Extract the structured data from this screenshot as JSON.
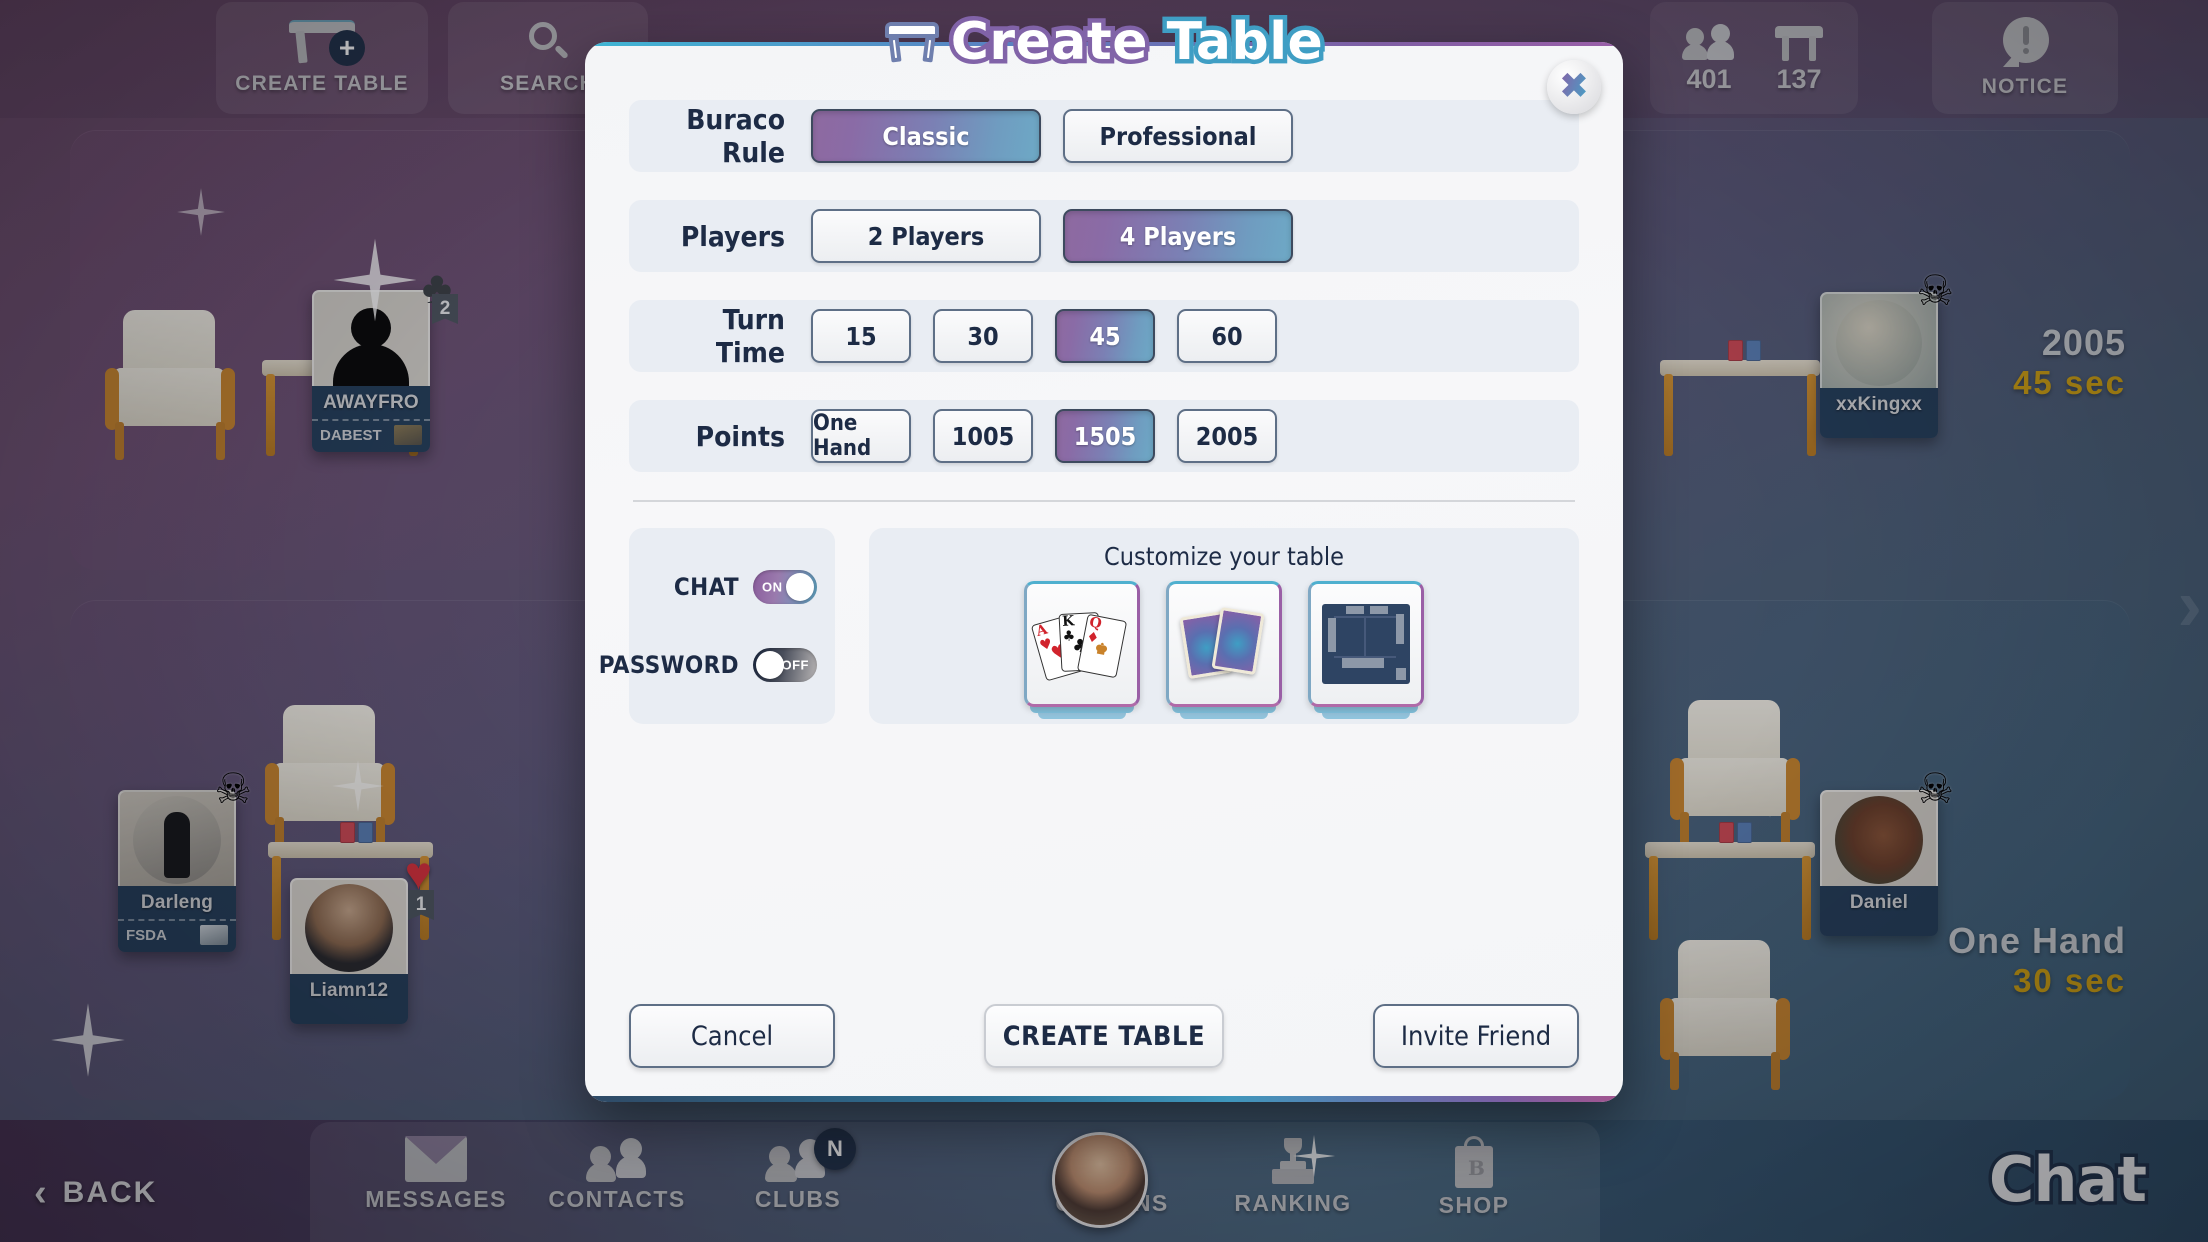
{
  "topbar": {
    "create_table_label": "CREATE TABLE",
    "search_label": "SEARCH",
    "players_online": "401",
    "tables_count": "137",
    "notice_label": "NOTICE"
  },
  "modal": {
    "title_word1": "Create",
    "title_word2": "Table",
    "close_icon": "close-icon",
    "rows": [
      {
        "label": "Buraco Rule",
        "options": [
          {
            "label": "Classic",
            "selected": true
          },
          {
            "label": "Professional",
            "selected": false
          }
        ]
      },
      {
        "label": "Players",
        "options": [
          {
            "label": "2 Players",
            "selected": false
          },
          {
            "label": "4 Players",
            "selected": true
          }
        ]
      },
      {
        "label": "Turn Time",
        "options": [
          {
            "label": "15",
            "selected": false
          },
          {
            "label": "30",
            "selected": false
          },
          {
            "label": "45",
            "selected": true
          },
          {
            "label": "60",
            "selected": false
          }
        ]
      },
      {
        "label": "Points",
        "options": [
          {
            "label": "One Hand",
            "selected": false
          },
          {
            "label": "1005",
            "selected": false
          },
          {
            "label": "1505",
            "selected": true
          },
          {
            "label": "2005",
            "selected": false
          }
        ]
      }
    ],
    "toggles": [
      {
        "label": "CHAT",
        "state": "ON",
        "on": true
      },
      {
        "label": "PASSWORD",
        "state": "OFF",
        "on": false
      }
    ],
    "customize": {
      "title": "Customize your table",
      "cards": [
        {
          "name": "card-faces-theme",
          "cards": [
            {
              "rank": "A",
              "suit": "♥",
              "color": "red"
            },
            {
              "rank": "K",
              "suit": "♣",
              "color": "black"
            },
            {
              "rank": "Q",
              "suit": "♦",
              "color": "red"
            }
          ]
        },
        {
          "name": "card-backs-theme"
        },
        {
          "name": "table-board-theme"
        }
      ]
    },
    "footer": {
      "cancel": "Cancel",
      "create": "CREATE TABLE",
      "invite": "Invite Friend"
    }
  },
  "lobby": {
    "players": [
      {
        "name": "AWAYFRO",
        "club": "DABEST",
        "badge": "club-suit",
        "badge_count": "2"
      },
      {
        "name": "xxKingxx",
        "club": null,
        "badge": "skull"
      },
      {
        "name": "Darleng",
        "club": "FSDA",
        "badge": "skull"
      },
      {
        "name": "Liamn12",
        "club": null,
        "badge": "heart",
        "badge_count": "1"
      },
      {
        "name": "Daniel",
        "club": null,
        "badge": "skull"
      }
    ],
    "tables": [
      {
        "points": "2005",
        "time": "45 sec"
      },
      {
        "points": "One Hand",
        "time": "30 sec"
      }
    ]
  },
  "bottomnav": {
    "back_label": "BACK",
    "items": [
      {
        "label": "MESSAGES",
        "icon": "envelope-icon",
        "badge": null
      },
      {
        "label": "CONTACTS",
        "icon": "people-icon",
        "badge": null
      },
      {
        "label": "CLUBS",
        "icon": "group-icon",
        "badge": "N"
      },
      {
        "label": "OPTIONS",
        "icon": "gear-icon",
        "badge": null
      },
      {
        "label": "RANKING",
        "icon": "trophy-icon",
        "badge": null
      },
      {
        "label": "SHOP",
        "icon": "shopping-bag-icon",
        "badge": null
      }
    ],
    "chat_label": "Chat"
  },
  "colors": {
    "accent_purple": "#8a5fa6",
    "accent_cyan": "#3fa7c9",
    "dark_navy": "#1d2b45",
    "row_bg": "#e9edf3",
    "gold": "#d1a313"
  }
}
